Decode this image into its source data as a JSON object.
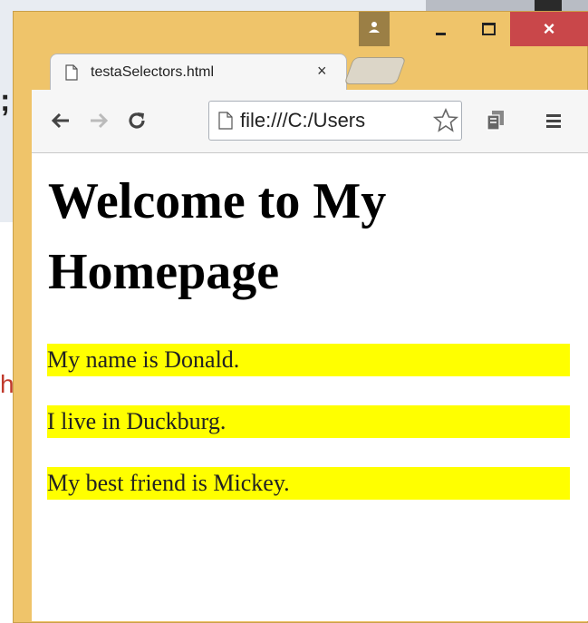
{
  "tab": {
    "title": "testaSelectors.html",
    "close_label": "×"
  },
  "window_controls": {
    "close_label": "×"
  },
  "address_bar": {
    "url": "file:///C:/Users"
  },
  "page": {
    "heading": "Welcome to My Homepage",
    "paragraphs": [
      "My name is Donald.",
      "I live in Duckburg.",
      "My best friend is Mickey."
    ],
    "highlight_color": "#ffff00"
  },
  "background_editor": {
    "semicolon": ";",
    "fragment": "h"
  },
  "colors": {
    "frame": "#efc46a",
    "close_button": "#c9474a"
  },
  "icons": [
    "page-icon",
    "close-icon",
    "back-icon",
    "forward-icon",
    "reload-icon",
    "star-icon",
    "extension-icon",
    "menu-icon",
    "profile-icon",
    "minimize-icon",
    "maximize-icon"
  ]
}
